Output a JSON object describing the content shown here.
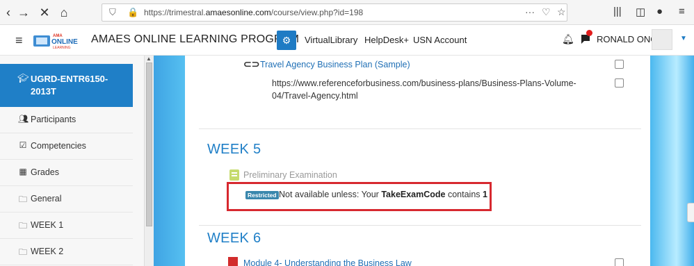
{
  "browser": {
    "url_prefix": "https://trimestral.",
    "url_domain": "amaesonline.com",
    "url_path": "/course/view.php?id=198",
    "more": "···"
  },
  "navbar": {
    "brand": "AMAES ONLINE LEARNING PROGRAM",
    "links": [
      "VirtualLibrary",
      "HelpDesk+",
      "USN Account"
    ],
    "user": "RONALD ONG"
  },
  "sidebar": {
    "course_code": "UGRD-ENTR6150-2013T",
    "items": [
      {
        "label": "Participants",
        "icon": "users-icon"
      },
      {
        "label": "Competencies",
        "icon": "check-square-icon"
      },
      {
        "label": "Grades",
        "icon": "table-icon"
      },
      {
        "label": "General",
        "icon": "folder-icon"
      },
      {
        "label": "WEEK 1",
        "icon": "folder-icon"
      },
      {
        "label": "WEEK 2",
        "icon": "folder-icon"
      }
    ]
  },
  "main": {
    "travel_link": "Travel Agency Business Plan (Sample)",
    "travel_url": "https://www.referenceforbusiness.com/business-plans/Business-Plans-Volume-04/Travel-Agency.html",
    "week5": "WEEK 5",
    "exam_name": "Preliminary Examination",
    "restricted_badge": "Restricted",
    "restriction_pre": "Not available unless: Your ",
    "restriction_field": "TakeExamCode",
    "restriction_mid": " contains ",
    "restriction_value": "1",
    "week6": "WEEK 6",
    "module4": "Module 4- Understanding the Business Law"
  },
  "colors": {
    "primary": "#1f7fc7",
    "highlight_border": "#d7282f",
    "badge": "#3a87ad"
  }
}
